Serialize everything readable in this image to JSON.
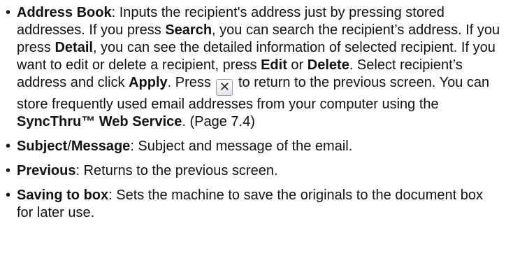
{
  "bullets": [
    {
      "parts": [
        "Address Book",
        ": Inputs the recipient's address just by pressing stored addresses. If you press ",
        "Search",
        ", you can search the recipient’s address. If you press ",
        "Detail",
        ", you can see the detailed information of selected recipient. If you want to edit or delete a recipient, press ",
        "Edit",
        " or ",
        "Delete",
        ". Select recipient’s address and click ",
        "Apply",
        ".  Press ",
        " to return to the previous screen. You can store frequently used email addresses from your computer using the ",
        "SyncThru™ Web Service",
        ". (Page 7.4)"
      ],
      "close_icon": "close-x-icon"
    },
    {
      "parts": [
        "Subject",
        "/",
        "Message",
        ": Subject and message of the email."
      ]
    },
    {
      "parts": [
        "Previous",
        ": Returns to the previous screen."
      ]
    },
    {
      "parts": [
        "Saving to box",
        ": Sets the machine to save the originals to the document box for later use."
      ]
    }
  ],
  "bullet_glyph": "•"
}
